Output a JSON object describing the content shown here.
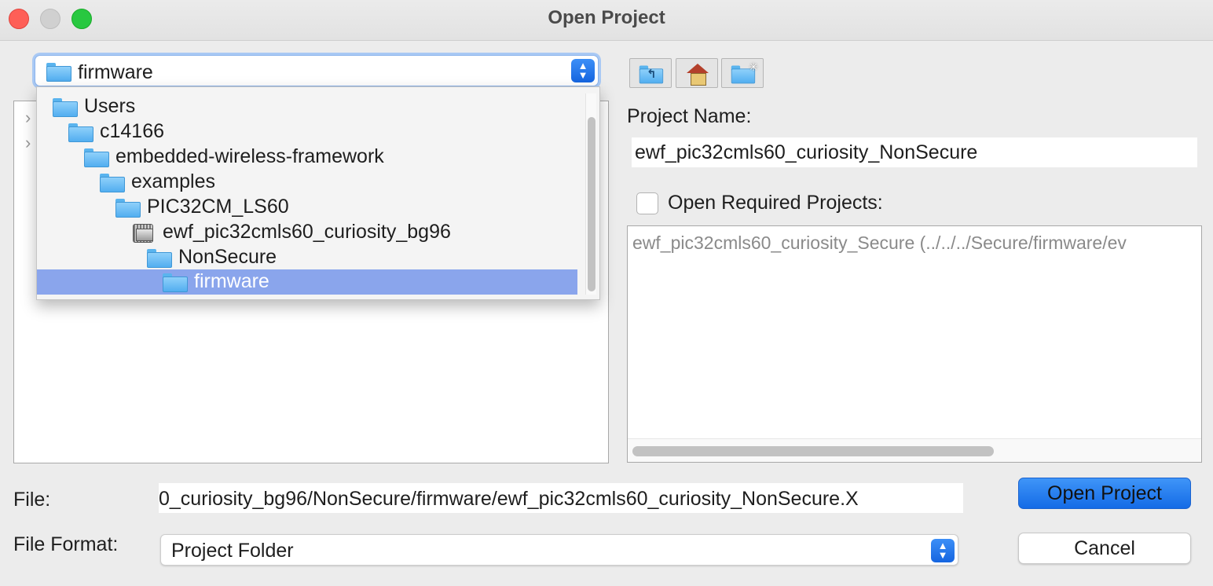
{
  "window": {
    "title": "Open Project"
  },
  "location": {
    "selected": "firmware",
    "path_items": [
      {
        "label": "Users",
        "icon": "folder-icon"
      },
      {
        "label": "c14166",
        "icon": "folder-icon"
      },
      {
        "label": "embedded-wireless-framework",
        "icon": "folder-icon"
      },
      {
        "label": "examples",
        "icon": "folder-icon"
      },
      {
        "label": "PIC32CM_LS60",
        "icon": "folder-icon"
      },
      {
        "label": "ewf_pic32cmls60_curiosity_bg96",
        "icon": "project-icon"
      },
      {
        "label": "NonSecure",
        "icon": "folder-icon"
      },
      {
        "label": "firmware",
        "icon": "folder-icon",
        "selected": true
      }
    ]
  },
  "toolbar": {
    "buttons": [
      "up-one-level-icon",
      "home-icon",
      "new-folder-icon"
    ]
  },
  "project": {
    "name_label": "Project Name:",
    "name_value": "ewf_pic32cmls60_curiosity_NonSecure",
    "required_label": "Open Required Projects:",
    "required_checked": false,
    "required_items": [
      "ewf_pic32cmls60_curiosity_Secure (../../../Secure/firmware/ev"
    ]
  },
  "file": {
    "label": "File:",
    "value": "0_curiosity_bg96/NonSecure/firmware/ewf_pic32cmls60_curiosity_NonSecure.X"
  },
  "format": {
    "label": "File Format:",
    "value": "Project Folder"
  },
  "actions": {
    "open": "Open Project",
    "cancel": "Cancel"
  },
  "colors": {
    "accent": "#1a6ee8",
    "selection": "#8aa5ec",
    "close": "#fe5f57",
    "zoom": "#28c840"
  }
}
